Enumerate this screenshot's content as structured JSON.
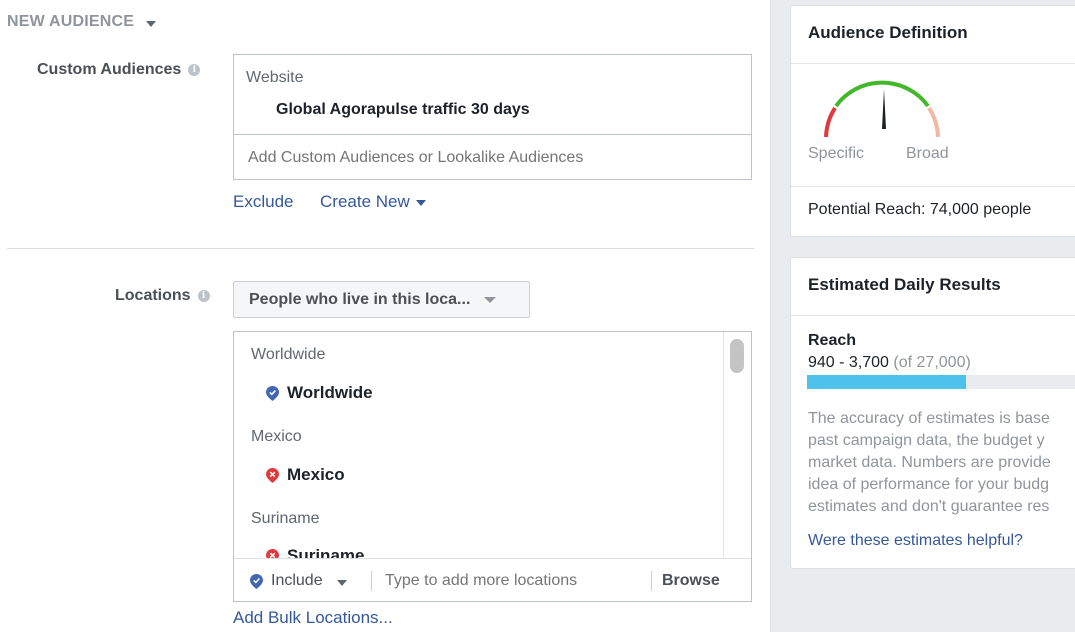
{
  "header": {
    "title": "NEW AUDIENCE"
  },
  "custom_audiences": {
    "label": "Custom Audiences",
    "group_title": "Website",
    "selected_item": "Global Agorapulse traffic 30 days",
    "input_placeholder": "Add Custom Audiences or Lookalike Audiences",
    "exclude_link": "Exclude",
    "create_new_link": "Create New"
  },
  "locations": {
    "label": "Locations",
    "mode_select": "People who live in this loca...",
    "groups": [
      {
        "title": "Worldwide",
        "item": "Worldwide",
        "pin": "included-pin-icon",
        "pin_color": "#4267b2"
      },
      {
        "title": "Mexico",
        "item": "Mexico",
        "pin": "excluded-pin-icon",
        "pin_color": "#e0393e"
      },
      {
        "title": "Suriname",
        "item": "Suriname",
        "pin": "excluded-pin-icon",
        "pin_color": "#e0393e"
      }
    ],
    "include_label": "Include",
    "input_placeholder": "Type to add more locations",
    "browse_label": "Browse",
    "bulk_link": "Add Bulk Locations..."
  },
  "audience_definition": {
    "title": "Audience Definition",
    "specific_label": "Specific",
    "broad_label": "Broad",
    "potential_reach": "Potential Reach: 74,000 people"
  },
  "estimated_results": {
    "title": "Estimated Daily Results",
    "reach_label": "Reach",
    "reach_range": "940 - 3,700",
    "reach_total": "(of 27,000)",
    "reach_fill_fraction": 0.58,
    "body_lines": [
      "The accuracy of estimates is base",
      "past campaign data, the budget y",
      "market data. Numbers are provide",
      "idea of performance for your budg",
      "estimates and don't guarantee res"
    ],
    "helpful_link": "Were these estimates helpful?"
  },
  "colors": {
    "link": "#365899",
    "bar_fill": "#4dc3eb",
    "gauge_green": "#42b72a",
    "gauge_red": "#e0393e",
    "gauge_pink": "#f5b5a5"
  }
}
